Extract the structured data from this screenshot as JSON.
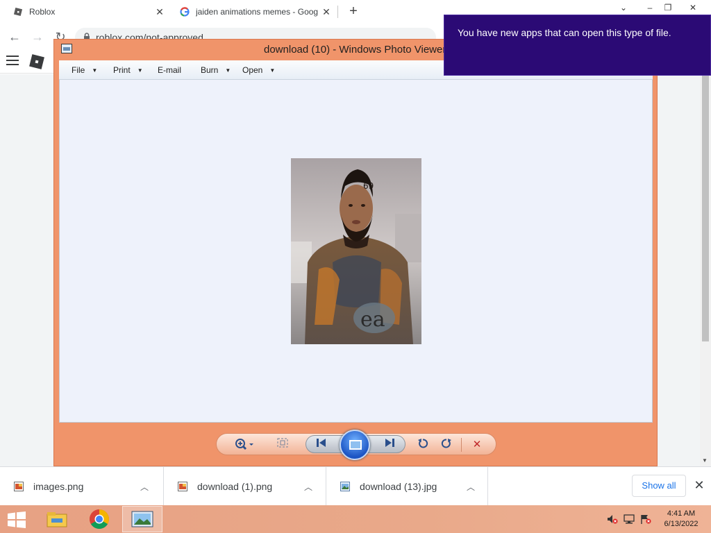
{
  "browser": {
    "tabs": [
      {
        "title": "Roblox",
        "favicon": "roblox-favicon"
      },
      {
        "title": "jaiden animations memes - Goog",
        "favicon": "google-favicon"
      }
    ],
    "new_tab_symbol": "+",
    "address": "roblox.com/not-approved",
    "window_controls": {
      "dropdown": "⌄",
      "minimize": "–",
      "restore": "❐",
      "close": "✕"
    },
    "nav": {
      "back": "←",
      "forward": "→",
      "reload": "↻"
    }
  },
  "photo_viewer": {
    "title": "download (10) - Windows Photo Viewer",
    "menu": [
      {
        "label": "File",
        "has_caret": true
      },
      {
        "label": "Print",
        "has_caret": true
      },
      {
        "label": "E-mail",
        "has_caret": false
      },
      {
        "label": "Burn",
        "has_caret": true
      },
      {
        "label": "Open",
        "has_caret": true
      }
    ],
    "frame_color": "#f0946a",
    "canvas_color": "#eef2fb"
  },
  "toast": {
    "message": "You have new apps that can open this type of file.",
    "background": "#2b0a75"
  },
  "downloads": {
    "items": [
      {
        "name": "images.png",
        "icon": "image-file-icon"
      },
      {
        "name": "download (1).png",
        "icon": "image-file-icon"
      },
      {
        "name": "download (13).jpg",
        "icon": "photo-file-icon"
      }
    ],
    "show_all_label": "Show all",
    "close_symbol": "✕"
  },
  "taskbar": {
    "time": "4:41 AM",
    "date": "6/13/2022"
  }
}
